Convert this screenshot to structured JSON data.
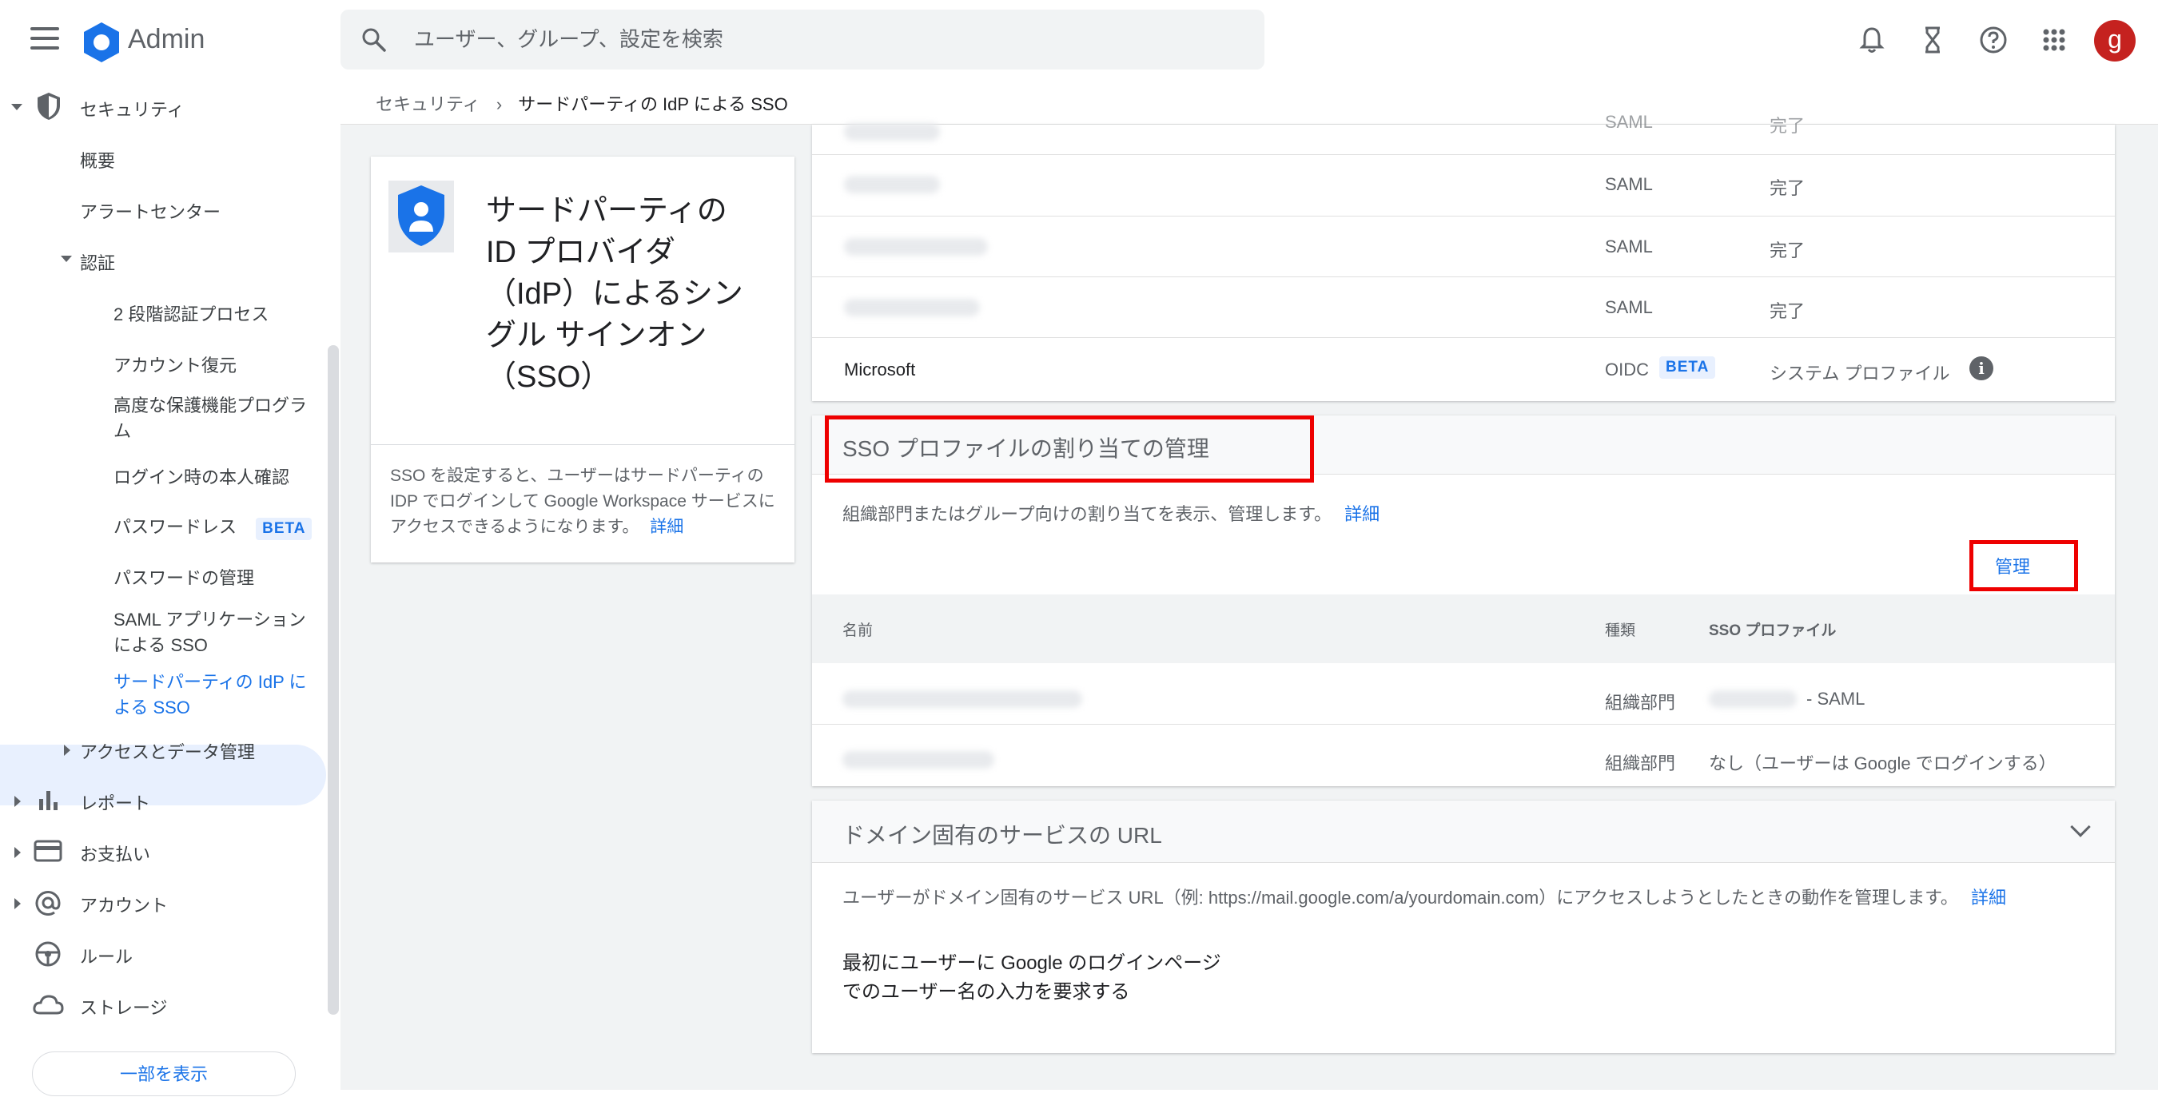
{
  "header": {
    "app_name": "Admin",
    "search_placeholder": "ユーザー、グループ、設定を検索",
    "avatar_letter": "g"
  },
  "sidebar": {
    "security": "セキュリティ",
    "overview": "概要",
    "alert_center": "アラートセンター",
    "auth": "認証",
    "two_step": "2 段階認証プロセス",
    "account_recovery": "アカウント復元",
    "advanced_protection": "高度な保護機能プログラム",
    "login_verification": "ログイン時の本人確認",
    "passwordless": "パスワードレス",
    "passwordless_badge": "BETA",
    "password_mgmt": "パスワードの管理",
    "saml_sso_line1": "SAML アプリケーション",
    "saml_sso_line2": "による SSO",
    "third_party_sso_line1": "サードパーティの IdP に",
    "third_party_sso_line2": "よる SSO",
    "access_data": "アクセスとデータ管理",
    "reports": "レポート",
    "billing": "お支払い",
    "account": "アカウント",
    "rules": "ルール",
    "storage": "ストレージ",
    "show_less": "一部を表示"
  },
  "breadcrumb": {
    "parent": "セキュリティ",
    "current": "サードパーティの IdP による SSO"
  },
  "info_card": {
    "title": "サードパーティの ID プロバイダ（IdP）によるシングル サインオン（SSO）",
    "description": "SSO を設定すると、ユーザーはサードパーティの IDP でログインして Google Workspace サービスにアクセスできるようになります。",
    "link": "詳細"
  },
  "profiles": {
    "rows": [
      {
        "type": "SAML",
        "status": "完了"
      },
      {
        "type": "SAML",
        "status": "完了"
      },
      {
        "type": "SAML",
        "status": "完了"
      },
      {
        "type": "SAML",
        "status": "完了"
      }
    ],
    "microsoft": {
      "name": "Microsoft",
      "type": "OIDC",
      "badge": "BETA",
      "status": "システム プロファイル"
    }
  },
  "assignment": {
    "title": "SSO プロファイルの割り当ての管理",
    "description": "組織部門またはグループ向けの割り当てを表示、管理します。",
    "link": "詳細",
    "manage_button": "管理",
    "columns": {
      "name": "名前",
      "type": "種類",
      "profile": "SSO プロファイル"
    },
    "rows": [
      {
        "type": "組織部門",
        "profile": "- SAML"
      },
      {
        "type": "組織部門",
        "profile": "なし（ユーザーは Google でログインする）"
      }
    ]
  },
  "domain_urls": {
    "title": "ドメイン固有のサービスの URL",
    "description": "ユーザーがドメイン固有のサービス URL（例: https://mail.google.com/a/yourdomain.com）にアクセスしようとしたときの動作を管理します。",
    "link": "詳細",
    "setting_line1": "最初にユーザーに Google のログインページ",
    "setting_line2": "でのユーザー名の入力を要求する"
  }
}
